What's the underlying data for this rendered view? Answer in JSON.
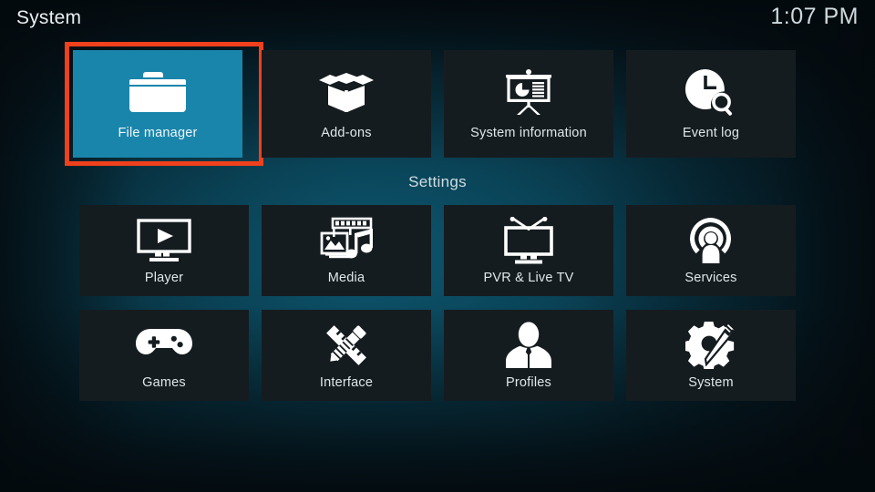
{
  "header": {
    "title": "System",
    "clock": "1:07 PM"
  },
  "colors": {
    "selected_tile": "#1a85ab",
    "focus_ring": "#f0401c",
    "tile_background": "#151c20",
    "background_teal": "#0d5770",
    "label_text": "#dfe7ea"
  },
  "sections": {
    "settings_heading": "Settings"
  },
  "top_row": [
    {
      "label": "File manager",
      "icon": "folder-icon",
      "selected": true
    },
    {
      "label": "Add-ons",
      "icon": "open-box-icon",
      "selected": false
    },
    {
      "label": "System information",
      "icon": "presentation-chart-icon",
      "selected": false
    },
    {
      "label": "Event log",
      "icon": "clock-magnifier-icon",
      "selected": false
    }
  ],
  "settings_row_1": [
    {
      "label": "Player",
      "icon": "monitor-play-icon",
      "selected": false
    },
    {
      "label": "Media",
      "icon": "film-photo-music-icon",
      "selected": false
    },
    {
      "label": "PVR & Live TV",
      "icon": "tv-antenna-icon",
      "selected": false
    },
    {
      "label": "Services",
      "icon": "broadcast-person-icon",
      "selected": false
    }
  ],
  "settings_row_2": [
    {
      "label": "Games",
      "icon": "gamepad-icon",
      "selected": false
    },
    {
      "label": "Interface",
      "icon": "pencil-ruler-icon",
      "selected": false
    },
    {
      "label": "Profiles",
      "icon": "person-bust-icon",
      "selected": false
    },
    {
      "label": "System",
      "icon": "gear-screwdriver-icon",
      "selected": false
    }
  ]
}
